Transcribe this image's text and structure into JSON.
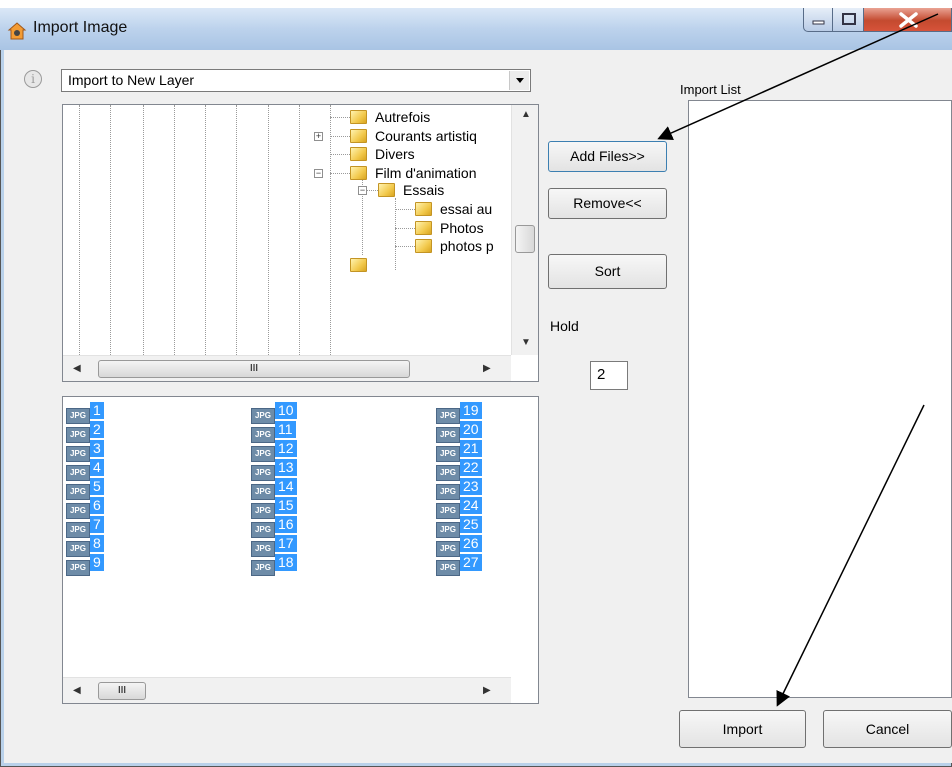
{
  "window": {
    "title": "Import Image",
    "controls": {
      "minimize_icon": "minimize-icon",
      "maximize_icon": "maximize-icon",
      "close_icon": "close-icon"
    }
  },
  "layer_select": {
    "value": "Import to New Layer"
  },
  "tree": {
    "items": [
      "Autrefois",
      "Courants artistiq",
      "Divers",
      "Film d'animation",
      "Essais",
      "essai au",
      "Photos",
      "photos p"
    ],
    "expanders": [
      "+",
      "−",
      "−"
    ],
    "hscroll_thumb_label": "III"
  },
  "file_list": {
    "items": [
      "1",
      "2",
      "3",
      "4",
      "5",
      "6",
      "7",
      "8",
      "9",
      "10",
      "11",
      "12",
      "13",
      "14",
      "15",
      "16",
      "17",
      "18",
      "19",
      "20",
      "21",
      "22",
      "23",
      "24",
      "25",
      "26",
      "27"
    ],
    "file_badge": "JPG",
    "hscroll_thumb_label": "III"
  },
  "buttons": {
    "add_files": "Add Files>>",
    "remove": "Remove<<",
    "sort": "Sort",
    "import": "Import",
    "cancel": "Cancel"
  },
  "hold": {
    "label": "Hold",
    "value": "2"
  },
  "import_list": {
    "label": "Import List"
  },
  "colors": {
    "selection": "#3399ff",
    "titlebar": "#bcd2ec",
    "close": "#c44a2f"
  }
}
